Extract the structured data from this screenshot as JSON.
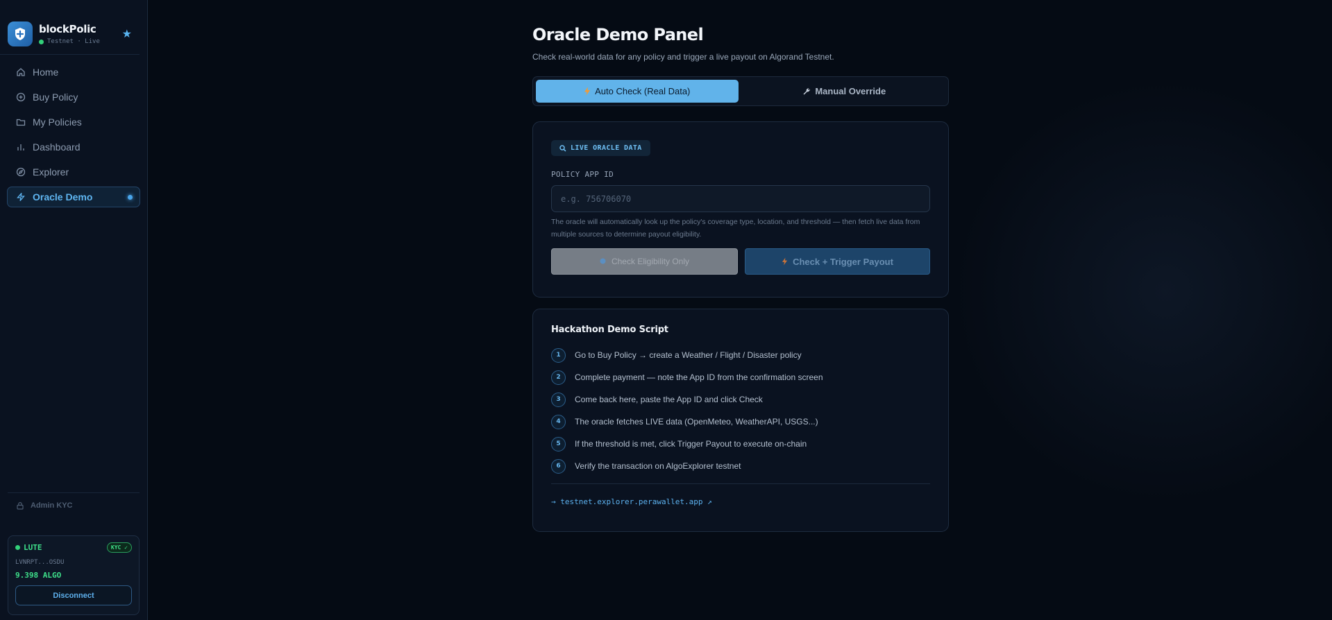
{
  "brand": {
    "name": "blockPolic",
    "network": "Testnet · Live"
  },
  "nav": {
    "home": "Home",
    "buy_policy": "Buy Policy",
    "my_policies": "My Policies",
    "dashboard": "Dashboard",
    "explorer": "Explorer",
    "oracle_demo": "Oracle Demo"
  },
  "admin": {
    "label": "Admin KYC"
  },
  "wallet": {
    "name": "LUTE",
    "kyc": "KYC ✓",
    "address": "LVNRPT...OSDU",
    "balance": "9.398 ALGO",
    "disconnect": "Disconnect"
  },
  "page": {
    "title": "Oracle Demo Panel",
    "subtitle": "Check real-world data for any policy and trigger a live payout on Algorand Testnet."
  },
  "tabs": {
    "auto": "Auto Check (Real Data)",
    "manual": "Manual Override"
  },
  "oracle": {
    "badge": "LIVE ORACLE DATA",
    "field_label": "POLICY APP ID",
    "placeholder": "e.g. 756706070",
    "value": "",
    "help": "The oracle will automatically look up the policy's coverage type, location, and threshold — then fetch live data from multiple sources to determine payout eligibility.",
    "check_btn": "Check Eligibility Only",
    "trigger_btn": "Check + Trigger Payout"
  },
  "script": {
    "title": "Hackathon Demo Script",
    "steps": [
      {
        "num": "1",
        "text": "Go to Buy Policy → create a Weather / Flight / Disaster policy"
      },
      {
        "num": "2",
        "text": "Complete payment — note the App ID from the confirmation screen"
      },
      {
        "num": "3",
        "text": "Come back here, paste the App ID and click Check"
      },
      {
        "num": "4",
        "text": "The oracle fetches LIVE data (OpenMeteo, WeatherAPI, USGS...)"
      },
      {
        "num": "5",
        "text": "If the threshold is met, click Trigger Payout to execute on-chain"
      },
      {
        "num": "6",
        "text": "Verify the transaction on AlgoExplorer testnet"
      }
    ],
    "link": "→ testnet.explorer.perawallet.app ↗"
  },
  "colors": {
    "accent": "#61b3ea",
    "success": "#3ee08a",
    "background": "#050b14"
  }
}
